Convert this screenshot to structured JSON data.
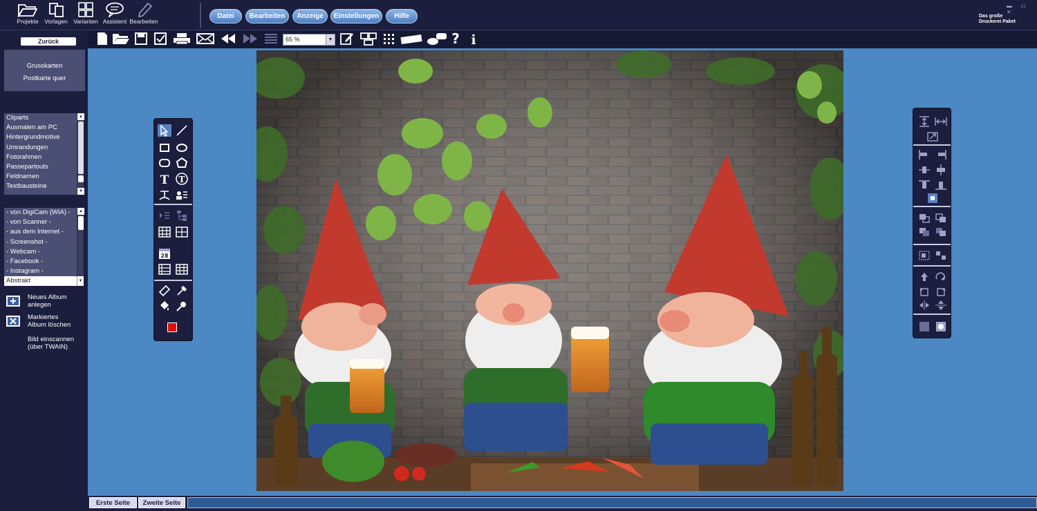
{
  "app": {
    "brand_line1": "Das große",
    "brand_line2": "Druckerei Paket",
    "window_controls": "▬ ▭ ✕"
  },
  "top_tools": [
    {
      "label": "Projekte",
      "icon": "folder-open-icon"
    },
    {
      "label": "Vorlagen",
      "icon": "templates-icon"
    },
    {
      "label": "Varianten",
      "icon": "grid-icon"
    },
    {
      "label": "Assistent",
      "icon": "speech-bubble-icon"
    },
    {
      "label": "Bearbeiten",
      "icon": "pencil-icon"
    }
  ],
  "menu": {
    "datei": "Datei",
    "bearbeiten": "Bearbeiten",
    "anzeige": "Anzeige",
    "einstellungen": "Einstellungen",
    "hilfe": "Hilfe"
  },
  "toolbar": {
    "zoom_value": "65 %",
    "icons": [
      "new-document-icon",
      "open-folder-icon",
      "save-icon",
      "checkbox-icon",
      "print-icon",
      "email-icon",
      "first-page-icon",
      "next-page-icon",
      "align-icon",
      "edit-icon",
      "layout-icon",
      "grid-icon",
      "ruler-icon",
      "users-icon",
      "help-icon",
      "info-icon"
    ]
  },
  "sidebar": {
    "back_label": "Zurück",
    "category_line1": "Grusskarten",
    "category_line2": "Postkarte quer",
    "clipart_list": [
      "Cliparts",
      "Ausmalen am PC",
      "Hintergrundmotive",
      "Umrandungen",
      "Fotorahmen",
      "Passepartouts",
      "Feldnamen",
      "Textbausteine"
    ],
    "source_list": [
      "- von DigiCam (WIA) -",
      "- von Scanner -",
      "- aus dem Internet -",
      "- Screenshot -",
      "- Webcam -",
      "- Facebook -",
      "- Instagram -"
    ],
    "album_selected": "Abstrakt",
    "new_album_l1": "Neues Album",
    "new_album_l2": "anlegen",
    "delete_album_l1": "Markiertes",
    "delete_album_l2": "Album löschen",
    "scan_l1": "Bild einscannen",
    "scan_l2": "(über TWAIN)"
  },
  "pages": {
    "first": "Erste Seite",
    "second": "Zweite Seite"
  },
  "colors": {
    "canvas_bg": "#4c88c4",
    "chrome_bg": "#1b1e3d",
    "menu_pill": "#5f8fcf",
    "active_color": "#e01010"
  }
}
